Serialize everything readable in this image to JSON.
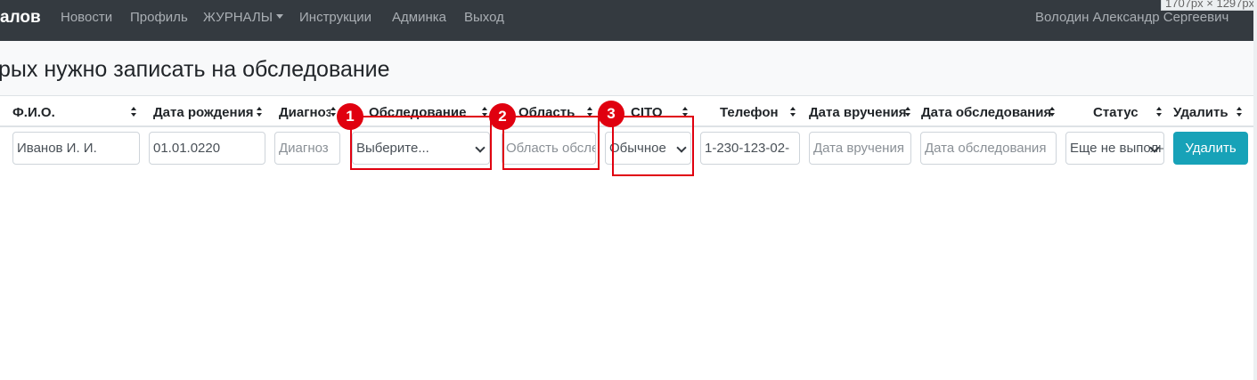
{
  "navbar": {
    "brand": "алов",
    "links": [
      "Новости",
      "Профиль",
      "ЖУРНАЛЫ",
      "Инструкции",
      "Админка",
      "Выход"
    ],
    "user": "Володин Александр Сергеевич",
    "dimension_badge": "1707px × 1297px"
  },
  "page": {
    "title": "рых нужно записать на обследование"
  },
  "table": {
    "columns": [
      "Ф.И.О.",
      "Дата рождения",
      "Диагноз",
      "Обследование",
      "Область",
      "CITO",
      "Телефон",
      "Дата вручения",
      "Дата обследования",
      "Статус",
      "Удалить"
    ],
    "row": {
      "fio": "Иванов И. И.",
      "birth_date": "01.01.0220",
      "diagnosis_placeholder": "Диагноз",
      "exam_select": "Выберите...",
      "area_placeholder": "Область обследования",
      "cito_select": "Обычное",
      "phone": "1-230-123-02-",
      "handover_placeholder": "Дата вручения",
      "exam_date_placeholder": "Дата обследования",
      "status_select": "Еще не выполнено",
      "delete_label": "Удалить"
    }
  },
  "annotations": {
    "color": "#e0000f",
    "markers": [
      "1",
      "2",
      "3"
    ]
  },
  "colors": {
    "navbar_bg": "#343a40",
    "button_info": "#17a2b8"
  }
}
